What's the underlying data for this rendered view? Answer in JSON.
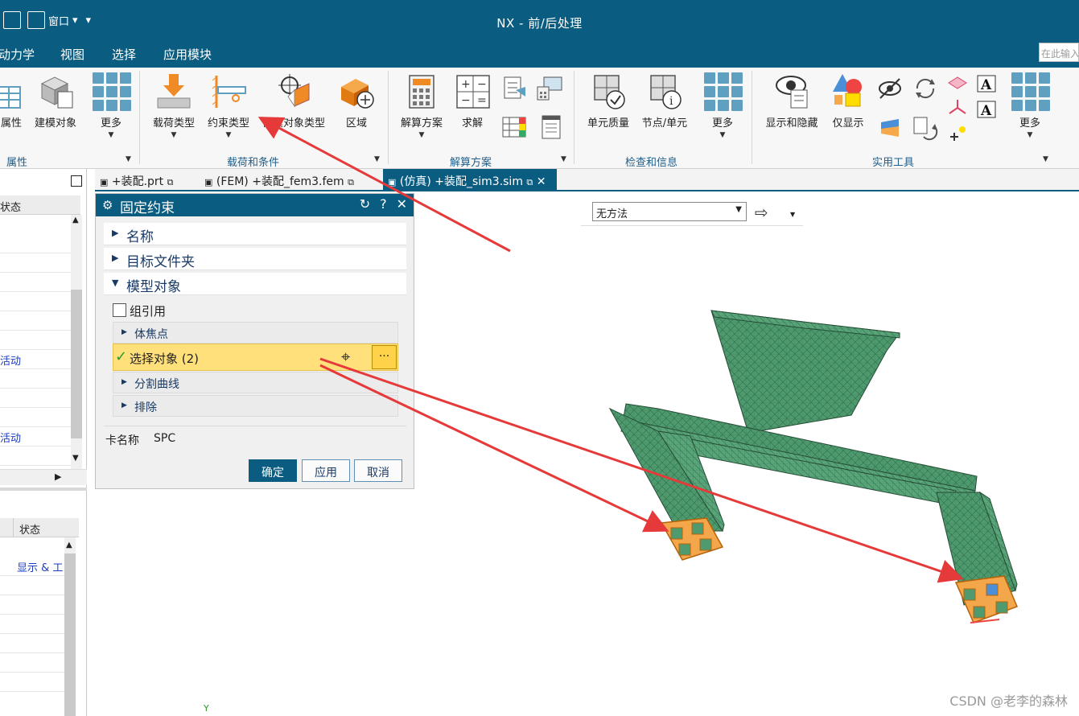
{
  "window": {
    "title": "NX - 前/后处理",
    "quick_access_window": "窗口",
    "dropdown_caret": "▾"
  },
  "menu": {
    "tabs": [
      "动力学",
      "视图",
      "选择",
      "应用模块"
    ],
    "search_placeholder": "在此输入"
  },
  "ribbon": {
    "groups": {
      "properties": "属性",
      "loads_conditions": "载荷和条件",
      "solution": "解算方案",
      "check_info": "检查和信息",
      "utilities": "实用工具"
    },
    "buttons": {
      "properties": "属性",
      "modeling_objects": "建模对象",
      "more1": "更多",
      "load_type": "载荷类型",
      "constraint_type": "约束类型",
      "simulation_object_type": "仿真对象类型",
      "region": "区域",
      "solution": "解算方案",
      "solve": "求解",
      "element_quality": "单元质量",
      "node_element": "节点/单元",
      "more2": "更多",
      "show_hide": "显示和隐藏",
      "show_only": "仅显示",
      "more3": "更多"
    }
  },
  "navigator": {
    "status_header": "状态",
    "rows": [
      "活动",
      "活动"
    ],
    "status_header2": "状态",
    "show_row": "显示 & 工"
  },
  "doc_tabs": [
    {
      "label": "+装配.prt"
    },
    {
      "label": "(FEM) +装配_fem3.fem"
    },
    {
      "label": "(仿真) +装配_sim3.sim"
    }
  ],
  "viewport": {
    "method_dropdown": "无方法",
    "axis_label": "Y",
    "watermark": "CSDN @老李的森林"
  },
  "dialog": {
    "title": "固定约束",
    "sections": {
      "name": "名称",
      "target_folder": "目标文件夹",
      "model_objects": "模型对象"
    },
    "group_reference": "组引用",
    "subsections": {
      "body_focus": "体焦点",
      "select_objects": "选择对象 (2)",
      "split_curves": "分割曲线",
      "exclude": "排除"
    },
    "card_name_label": "卡名称",
    "card_name_value": "SPC",
    "buttons": {
      "ok": "确定",
      "apply": "应用",
      "cancel": "取消"
    },
    "more_dots": "···"
  },
  "colors": {
    "title_bar": "#0a5c80",
    "mesh_green": "#4f9a6e",
    "highlight_orange": "#f0962a",
    "selection_yellow": "#ffe07a",
    "annotation_red": "#e63a3a"
  }
}
